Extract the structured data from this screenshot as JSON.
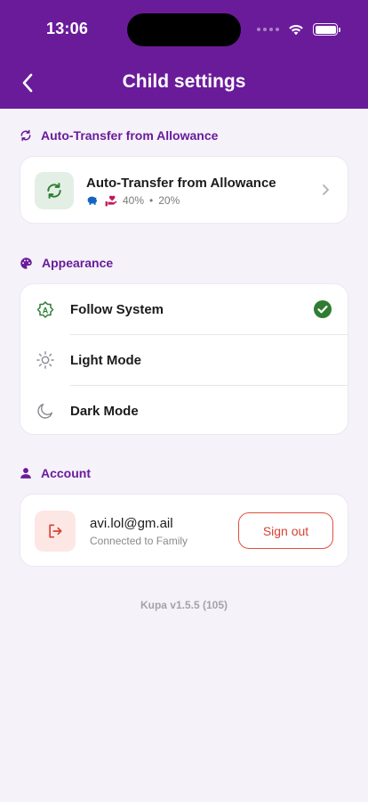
{
  "status_bar": {
    "time": "13:06"
  },
  "header": {
    "title": "Child settings",
    "back_icon": "chevron-left-icon"
  },
  "colors": {
    "brand": "#6a1b9a",
    "success": "#2e7d32",
    "danger": "#d84233"
  },
  "sections": {
    "auto_transfer": {
      "title": "Auto-Transfer from Allowance",
      "card_title": "Auto-Transfer from Allowance",
      "first_percent": "40%",
      "separator": "•",
      "second_percent": "20%"
    },
    "appearance": {
      "title": "Appearance",
      "options": [
        {
          "label": "Follow System",
          "icon": "auto-theme-icon",
          "selected": true
        },
        {
          "label": "Light Mode",
          "icon": "sun-icon",
          "selected": false
        },
        {
          "label": "Dark Mode",
          "icon": "moon-icon",
          "selected": false
        }
      ]
    },
    "account": {
      "title": "Account",
      "email": "avi.lol@gm.ail",
      "subtitle": "Connected to Family",
      "sign_out_label": "Sign out"
    }
  },
  "footer": {
    "version": "Kupa v1.5.5 (105)"
  }
}
